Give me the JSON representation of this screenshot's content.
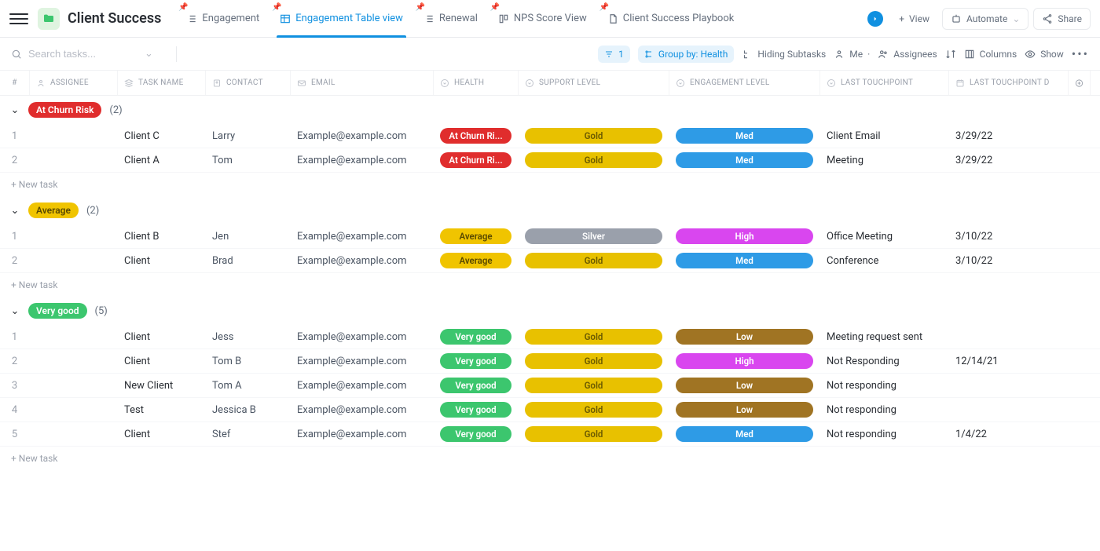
{
  "title": "Client Success",
  "tabs": [
    {
      "label": "Engagement",
      "icon": "list"
    },
    {
      "label": "Engagement Table view",
      "icon": "table",
      "active": true
    },
    {
      "label": "Renewal",
      "icon": "list"
    },
    {
      "label": "NPS Score View",
      "icon": "board"
    },
    {
      "label": "Client Success Playbook",
      "icon": "doc"
    }
  ],
  "topbar_actions": {
    "view": "View",
    "automate": "Automate",
    "share": "Share"
  },
  "search": {
    "placeholder": "Search tasks..."
  },
  "toolbar": {
    "filter_count": "1",
    "group_by": "Group by: Health",
    "hiding": "Hiding Subtasks",
    "me": "Me",
    "assignees": "Assignees",
    "columns": "Columns",
    "show": "Show"
  },
  "columns": [
    "#",
    "ASSIGNEE",
    "TASK NAME",
    "CONTACT",
    "EMAIL",
    "HEALTH",
    "SUPPORT LEVEL",
    "ENGAGEMENT LEVEL",
    "LAST TOUCHPOINT",
    "LAST TOUCHPOINT D"
  ],
  "colors": {
    "at_churn": "#e02d2d",
    "average": "#f0c400",
    "very_good": "#3cc66e",
    "gold": "#e8c100",
    "silver": "#9aa0ab",
    "med": "#2e9be6",
    "high": "#d946ef",
    "low": "#a07423",
    "average_text": "#6b5b00"
  },
  "new_task_label": "+ New task",
  "groups": [
    {
      "name": "At Churn Risk",
      "badge_color": "at_churn",
      "count": "(2)",
      "rows": [
        {
          "n": "1",
          "task": "Client C",
          "contact": "Larry",
          "email": "Example@example.com",
          "health": "At Churn Ri...",
          "health_color": "at_churn",
          "support": "Gold",
          "support_color": "gold",
          "engage": "Med",
          "engage_color": "med",
          "touch": "Client Email",
          "date": "3/29/22"
        },
        {
          "n": "2",
          "task": "Client A",
          "contact": "Tom",
          "email": "Example@example.com",
          "health": "At Churn Ri...",
          "health_color": "at_churn",
          "support": "Gold",
          "support_color": "gold",
          "engage": "Med",
          "engage_color": "med",
          "touch": "Meeting",
          "date": "3/29/22"
        }
      ]
    },
    {
      "name": "Average",
      "badge_color": "average",
      "count": "(2)",
      "badge_text_dark": true,
      "rows": [
        {
          "n": "1",
          "task": "Client B",
          "contact": "Jen",
          "email": "Example@example.com",
          "health": "Average",
          "health_color": "average",
          "health_text_dark": true,
          "support": "Silver",
          "support_color": "silver",
          "engage": "High",
          "engage_color": "high",
          "touch": "Office Meeting",
          "date": "3/10/22"
        },
        {
          "n": "2",
          "task": "Client",
          "contact": "Brad",
          "email": "Example@example.com",
          "health": "Average",
          "health_color": "average",
          "health_text_dark": true,
          "support": "Gold",
          "support_color": "gold",
          "engage": "Med",
          "engage_color": "med",
          "touch": "Conference",
          "date": "3/10/22"
        }
      ]
    },
    {
      "name": "Very good",
      "badge_color": "very_good",
      "count": "(5)",
      "rows": [
        {
          "n": "1",
          "task": "Client",
          "contact": "Jess",
          "email": "Example@example.com",
          "health": "Very good",
          "health_color": "very_good",
          "support": "Gold",
          "support_color": "gold",
          "engage": "Low",
          "engage_color": "low",
          "touch": "Meeting request sent",
          "date": ""
        },
        {
          "n": "2",
          "task": "Client",
          "contact": "Tom B",
          "email": "Example@example.com",
          "health": "Very good",
          "health_color": "very_good",
          "support": "Gold",
          "support_color": "gold",
          "engage": "High",
          "engage_color": "high",
          "touch": "Not Responding",
          "date": "12/14/21"
        },
        {
          "n": "3",
          "task": "New Client",
          "contact": "Tom A",
          "email": "Example@example.com",
          "health": "Very good",
          "health_color": "very_good",
          "support": "Gold",
          "support_color": "gold",
          "engage": "Low",
          "engage_color": "low",
          "touch": "Not responding",
          "date": ""
        },
        {
          "n": "4",
          "task": "Test",
          "contact": "Jessica B",
          "email": "Example@example.com",
          "health": "Very good",
          "health_color": "very_good",
          "support": "Gold",
          "support_color": "gold",
          "engage": "Low",
          "engage_color": "low",
          "touch": "Not responding",
          "date": ""
        },
        {
          "n": "5",
          "task": "Client",
          "contact": "Stef",
          "email": "Example@example.com",
          "health": "Very good",
          "health_color": "very_good",
          "support": "Gold",
          "support_color": "gold",
          "engage": "Med",
          "engage_color": "med",
          "touch": "Not responding",
          "date": "1/4/22"
        }
      ]
    }
  ]
}
